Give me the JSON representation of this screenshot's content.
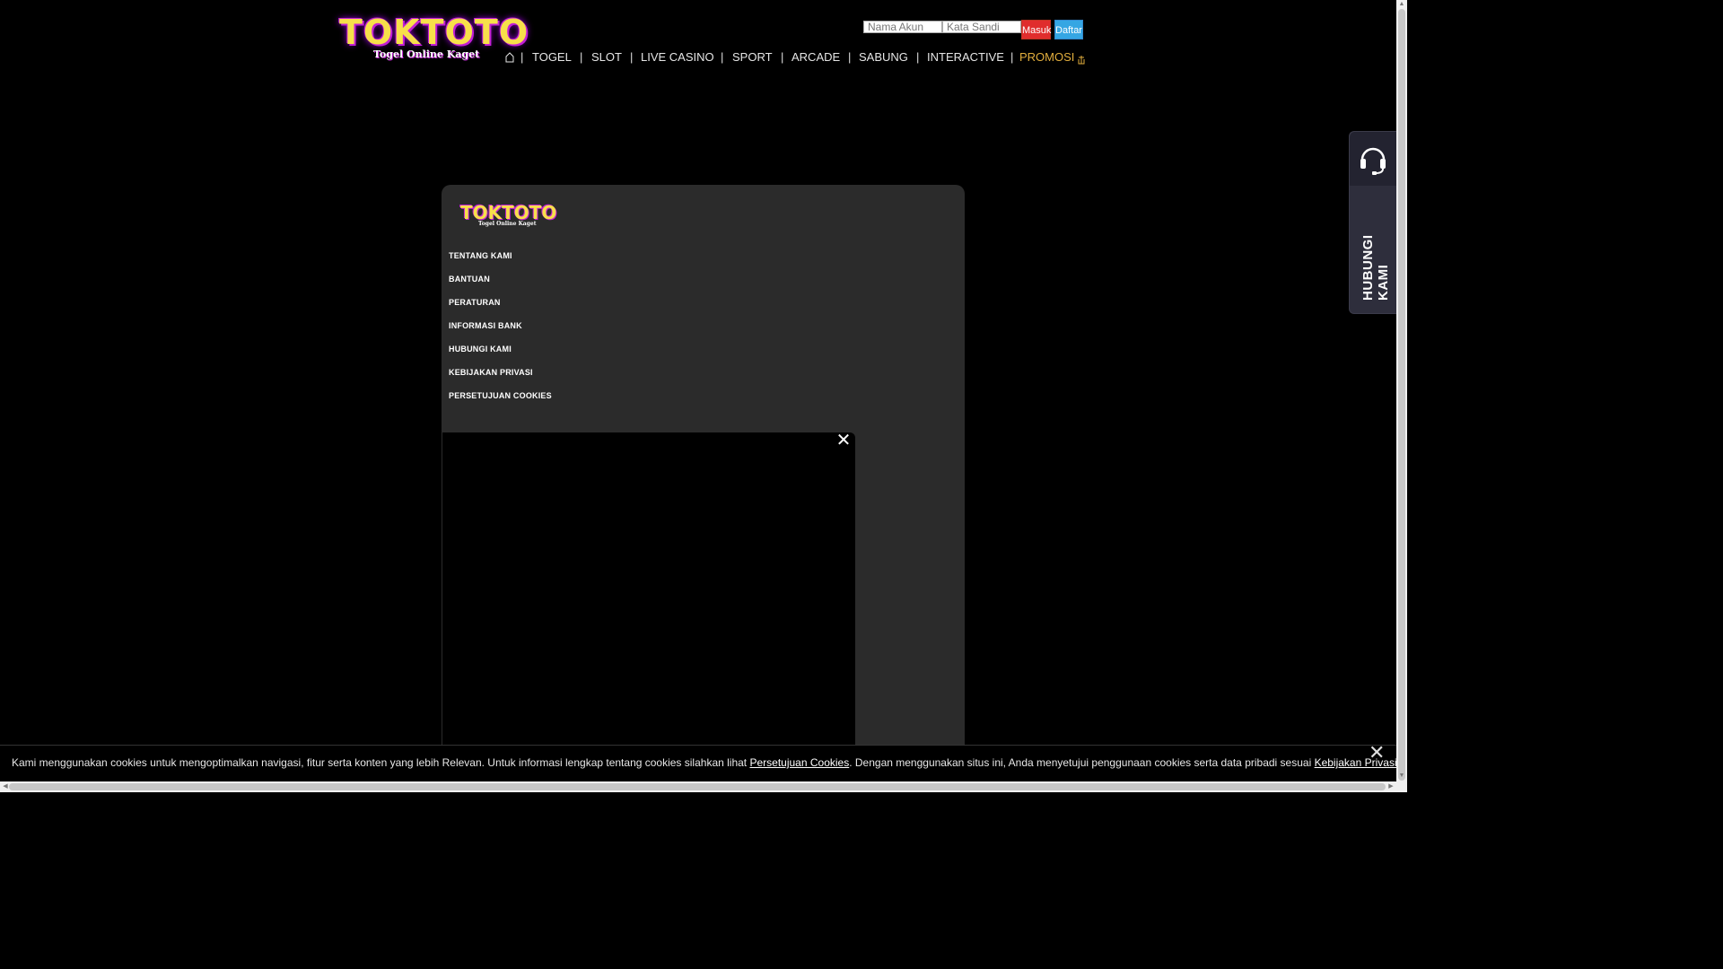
{
  "header": {
    "logo_main": "TOKTOTO",
    "logo_sub": "Togel Online Kaget",
    "login": {
      "username_placeholder": "Nama Akun",
      "password_placeholder": "Kata Sandi",
      "login_label": "Masuk",
      "register_label": "Daftar"
    },
    "nav": {
      "home_icon": "home-icon",
      "items": [
        "TOGEL",
        "SLOT",
        "LIVE CASINO",
        "SPORT",
        "ARCADE",
        "SABUNG",
        "INTERACTIVE",
        "PROMOSI"
      ],
      "separator": "|",
      "promo_color": "#e2ae3d"
    }
  },
  "side_widget": {
    "icon": "headset-icon",
    "label": "HUBUNGI KAMI"
  },
  "footer_panel": {
    "logo_main": "TOKTOTO",
    "logo_sub": "Togel Online Kaget",
    "links": [
      "TENTANG KAMI",
      "BANTUAN",
      "PERATURAN",
      "INFORMASI BANK",
      "HUBUNGI KAMI",
      "KEBIJAKAN PRIVASI",
      "PERSETUJUAN COOKIES"
    ]
  },
  "popup": {
    "close_icon": "close-icon"
  },
  "cookie_bar": {
    "text_1": "Kami menggunakan cookies untuk mengoptimalkan navigasi, fitur serta konten yang lebih Relevan. Untuk informasi lengkap tentang cookies silahkan lihat ",
    "link_1": "Persetujuan Cookies",
    "text_2": ". Dengan menggunakan situs ini, Anda menyetujui penggunaan cookies serta data pribadi sesuai ",
    "link_2": "Kebijakan Privasi",
    "text_3": ".",
    "close_icon": "close-icon"
  },
  "colors": {
    "background": "#000000",
    "panel": "#2b2b2b",
    "login_button": "#e02d2d",
    "register_button": "#35a6e3",
    "logo_yellow": "#f7e04a",
    "logo_purple": "#c21fd6"
  }
}
